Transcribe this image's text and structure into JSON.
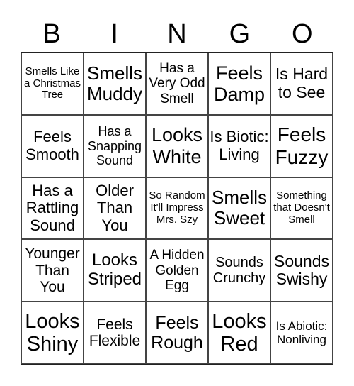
{
  "header": [
    "B",
    "I",
    "N",
    "G",
    "O"
  ],
  "cells": [
    "Smells Like a Christmas Tree",
    "Smells Muddy",
    "Has a Very Odd Smell",
    "Feels Damp",
    "Is Hard to See",
    "Feels Smooth",
    "Has a Snapping Sound",
    "Looks White",
    "Is Biotic: Living",
    "Feels Fuzzy",
    "Has a Rattling Sound",
    "Older Than You",
    "So Random It'll Impress Mrs. Szy",
    "Smells Sweet",
    "Something that Doesn't Smell",
    "Younger Than You",
    "Looks Striped",
    "A Hidden Golden Egg",
    "Sounds Crunchy",
    "Sounds Swishy",
    "Looks Shiny",
    "Feels Flexible",
    "Feels Rough",
    "Looks Red",
    "Is Abiotic: Nonliving"
  ]
}
